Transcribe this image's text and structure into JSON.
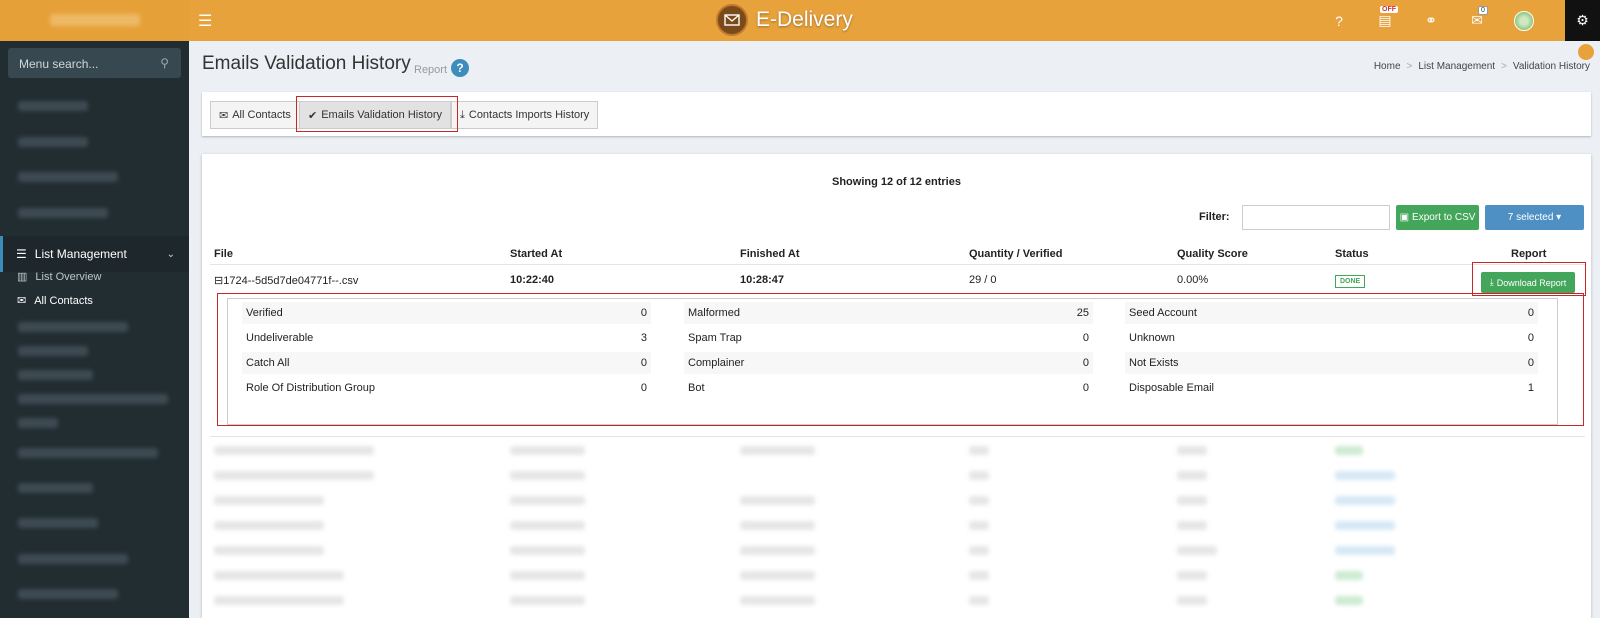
{
  "app": {
    "brand": "E-Delivery",
    "badge_off": "OFF",
    "mail_count": "0"
  },
  "sidebar": {
    "search_placeholder": "Menu search...",
    "list_management": "List Management",
    "sub_items": [
      "List Overview",
      "All Contacts"
    ]
  },
  "header": {
    "title": "Emails Validation History",
    "subtitle": "Report",
    "help": "?",
    "breadcrumb": [
      "Home",
      "List Management",
      "Validation History"
    ]
  },
  "tabs": {
    "all_contacts": "All Contacts",
    "validation_history": "Emails Validation History",
    "imports_history": "Contacts Imports History"
  },
  "table": {
    "showing": "Showing 12 of 12 entries",
    "filter_label": "Filter:",
    "export_label": "Export to CSV",
    "selected_label": "7 selected",
    "headers": [
      "File",
      "Started At",
      "Finished At",
      "Quantity / Verified",
      "Quality Score",
      "Status",
      "Report"
    ],
    "row": {
      "toggle": "⊟",
      "file": "1724--5d5d7de04771f--.csv",
      "started": "10:22:40",
      "finished": "10:28:47",
      "quantity": "29 / 0",
      "quality": "0.00%",
      "status": "DONE",
      "report_btn": "Download Report"
    },
    "details": [
      [
        {
          "label": "Verified",
          "value": "0"
        },
        {
          "label": "Malformed",
          "value": "25"
        },
        {
          "label": "Seed Account",
          "value": "0"
        }
      ],
      [
        {
          "label": "Undeliverable",
          "value": "3"
        },
        {
          "label": "Spam Trap",
          "value": "0"
        },
        {
          "label": "Unknown",
          "value": "0"
        }
      ],
      [
        {
          "label": "Catch All",
          "value": "0"
        },
        {
          "label": "Complainer",
          "value": "0"
        },
        {
          "label": "Not Exists",
          "value": "0"
        }
      ],
      [
        {
          "label": "Role Of Distribution Group",
          "value": "0"
        },
        {
          "label": "Bot",
          "value": "0"
        },
        {
          "label": "Disposable Email",
          "value": "1"
        }
      ]
    ]
  },
  "colors": {
    "topbar": "#e8a23c",
    "sidebar": "#222d32",
    "accent": "#3c8dbc",
    "success": "#43a65a",
    "highlight": "#c62828"
  }
}
